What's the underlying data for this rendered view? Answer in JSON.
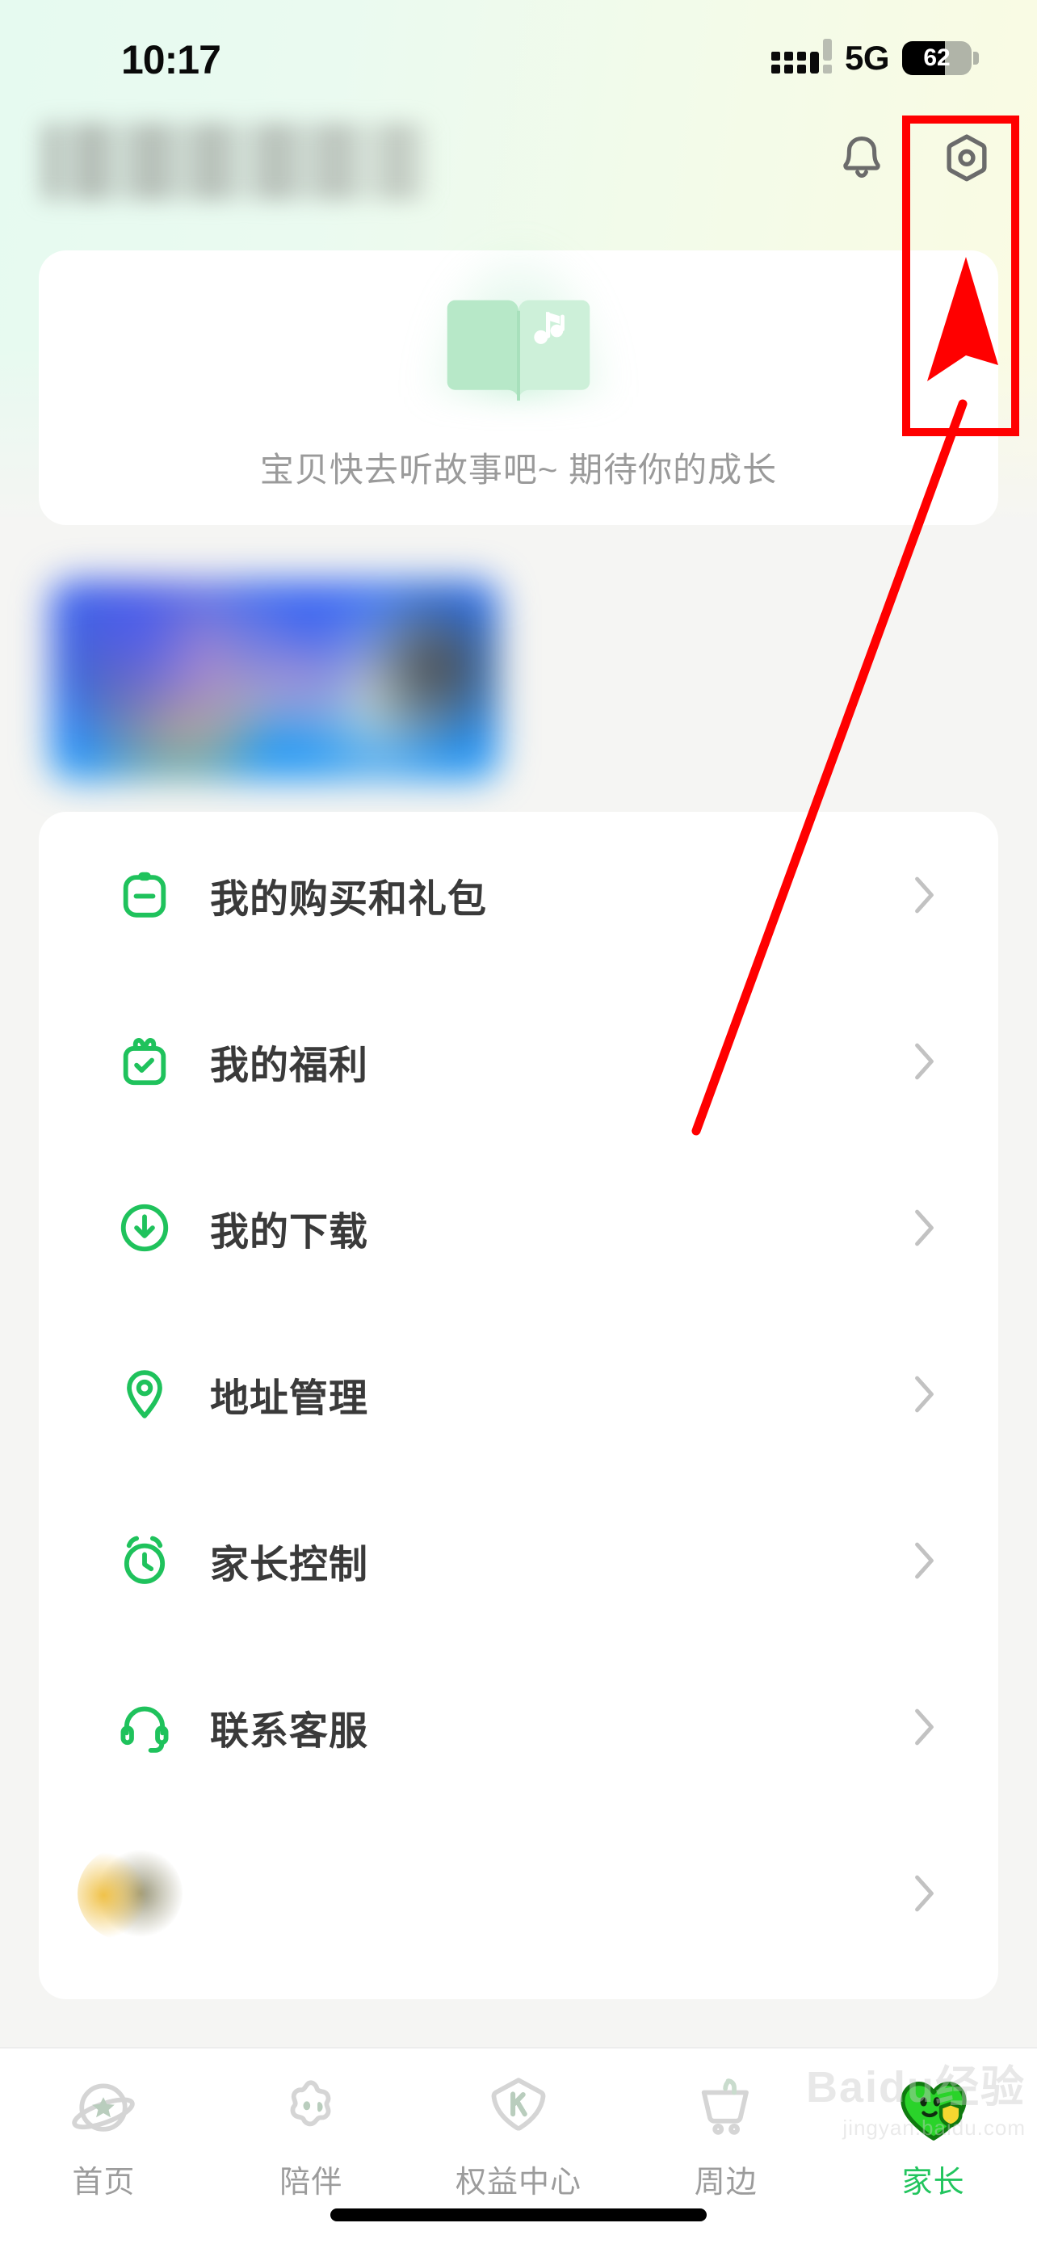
{
  "status_bar": {
    "time": "10:17",
    "network": "5G",
    "battery_percent": "62",
    "battery_level": 62,
    "signal_icon": "signal-bars-icon",
    "battery_icon": "battery-icon"
  },
  "header": {
    "username": "",
    "username_masked": true,
    "notification_icon": "bell-icon",
    "settings_icon": "settings-gear-icon"
  },
  "story_card": {
    "illustration_icon": "open-book-music-icon",
    "message": "宝贝快去听故事吧~ 期待你的成长"
  },
  "banner": {
    "masked": true,
    "alt": "promotional-banner"
  },
  "menu": {
    "items": [
      {
        "label": "我的购买和礼包",
        "icon": "clipboard-receipt-icon",
        "chevron": "chevron-right-icon",
        "masked": false
      },
      {
        "label": "我的福利",
        "icon": "gift-check-icon",
        "chevron": "chevron-right-icon",
        "masked": false
      },
      {
        "label": "我的下载",
        "icon": "download-circle-icon",
        "chevron": "chevron-right-icon",
        "masked": false
      },
      {
        "label": "地址管理",
        "icon": "location-pin-icon",
        "chevron": "chevron-right-icon",
        "masked": false
      },
      {
        "label": "家长控制",
        "icon": "alarm-clock-icon",
        "chevron": "chevron-right-icon",
        "masked": false
      },
      {
        "label": "联系客服",
        "icon": "headset-icon",
        "chevron": "chevron-right-icon",
        "masked": false
      },
      {
        "label": "",
        "icon": "masked-icon",
        "chevron": "chevron-right-icon",
        "masked": true
      }
    ]
  },
  "tab_bar": {
    "active_index": 4,
    "tabs": [
      {
        "label": "首页",
        "icon": "planet-icon"
      },
      {
        "label": "陪伴",
        "icon": "star-blob-icon"
      },
      {
        "label": "权益中心",
        "icon": "k-hexagon-icon"
      },
      {
        "label": "周边",
        "icon": "shopping-cart-icon"
      },
      {
        "label": "家长",
        "icon": "parent-heart-shield-icon"
      }
    ]
  },
  "watermark": {
    "main": "Baidu经验",
    "sub": "jingyan.baidu.com"
  },
  "annotation": {
    "type": "highlight-box-with-arrow",
    "color": "#ff0000",
    "target": "settings-gear-icon"
  },
  "colors": {
    "accent_green": "#22c55e",
    "icon_green": "#1fc25c",
    "text_primary": "#3a3a3a",
    "text_muted": "#9a9a9a",
    "card_bg": "#ffffff",
    "page_bg": "#f5f5f3",
    "annotation_red": "#ff0000"
  }
}
